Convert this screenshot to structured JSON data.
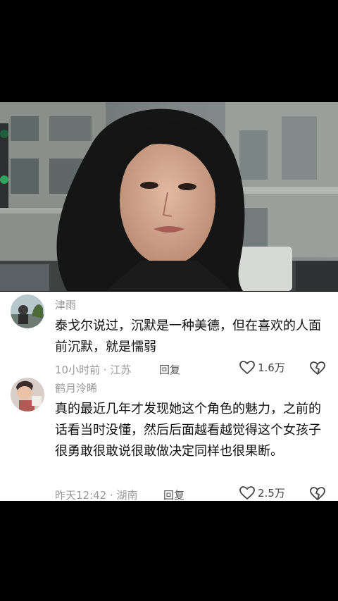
{
  "comments": [
    {
      "username": "津雨",
      "text": "泰戈尔说过，沉默是一种美德，但在喜欢的人面前沉默，就是懦弱",
      "time_location": "10小时前 · 江苏",
      "reply_label": "回复",
      "likes": "1.6万"
    },
    {
      "username": "鹤月泠晞",
      "text": "真的最近几年才发现她这个角色的魅力，之前的话看当时没懂，然后后面越看越觉得这个女孩子很勇敢很敢说很敢做决定同样也很果断。",
      "time_location": "昨天12:42 · 湖南",
      "reply_label": "回复",
      "likes": "2.5万"
    }
  ],
  "icons": {
    "like": "heart-outline-icon",
    "dislike": "broken-heart-outline-icon"
  }
}
